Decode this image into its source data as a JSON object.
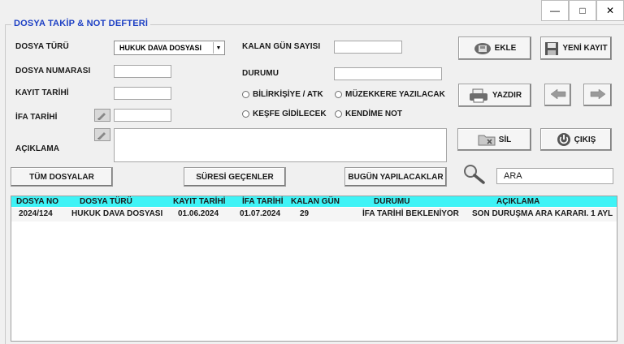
{
  "window": {
    "minimize": "—",
    "maximize": "□",
    "close": "✕"
  },
  "frame_title": "DOSYA TAKİP  &  NOT DEFTERİ",
  "form": {
    "dosya_turu_label": "DOSYA TÜRÜ",
    "dosya_turu_value": "HUKUK DAVA DOSYASI",
    "dosya_numarasi_label": "DOSYA NUMARASI",
    "kayit_tarihi_label": "KAYIT TARİHİ",
    "ifa_tarihi_label": "İFA TARİHİ",
    "aciklama_label": "AÇIKLAMA",
    "kalan_gun_label": "KALAN GÜN SAYISI",
    "durumu_label": "DURUMU",
    "radios": {
      "bilirkisiye": "BİLİRKİŞİYE / ATK",
      "muzekkere": "MÜZEKKERE YAZILACAK",
      "kesfe": "KEŞFE GİDİLECEK",
      "kendime": "KENDİME NOT"
    }
  },
  "buttons": {
    "ekle": "EKLE",
    "yeni_kayit": "YENİ KAYIT",
    "yazdir": "YAZDIR",
    "sil": "SİL",
    "cikis": "ÇIKIŞ",
    "tum_dosyalar": "TÜM DOSYALAR",
    "suresi_gecenler": "SÜRESİ GEÇENLER",
    "bugun_yapilacaklar": "BUGÜN YAPILACAKLAR"
  },
  "search": {
    "value": "ARA"
  },
  "table": {
    "headers": [
      "DOSYA NO",
      "DOSYA TÜRÜ",
      "KAYIT TARİHİ",
      "İFA TARİHİ",
      "KALAN GÜN",
      "DURUMU",
      "AÇIKLAMA"
    ],
    "rows": [
      [
        "2024/124",
        "HUKUK DAVA DOSYASI",
        "01.06.2024",
        "01.07.2024",
        "29",
        "İFA TARİHİ BEKLENİYOR",
        "SON DURUŞMA ARA KARARI. 1 AYL"
      ]
    ]
  }
}
